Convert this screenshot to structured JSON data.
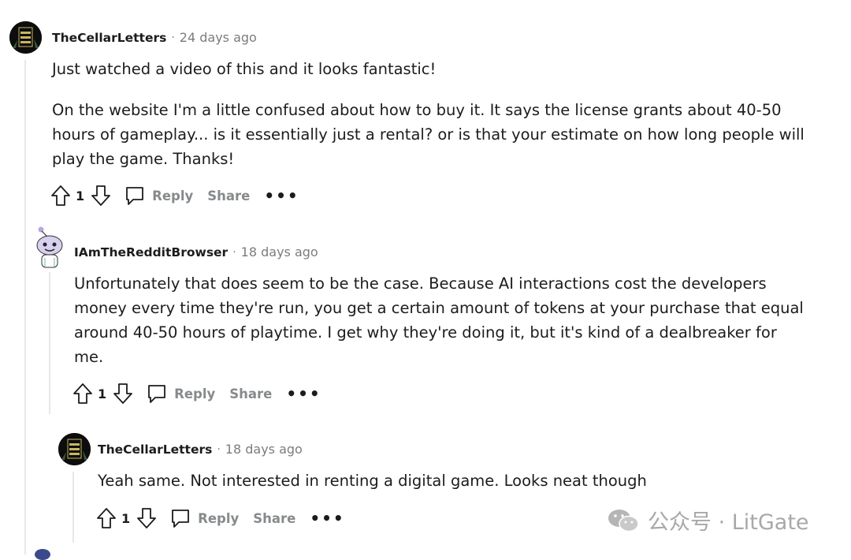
{
  "comments": [
    {
      "author": "TheCellarLetters",
      "time": "24 days ago",
      "paragraphs": [
        "Just watched a video of this and it looks fantastic!",
        "On the website I'm a little confused about how to buy it. It says the license grants about 40-50 hours of gameplay... is it essentially just a rental? or is that your estimate on how long people will play the game. Thanks!"
      ],
      "score": "1",
      "reply_label": "Reply",
      "share_label": "Share",
      "more_label": "•••",
      "avatar_text": "CELLAR LETTERS"
    },
    {
      "author": "IAmTheRedditBrowser",
      "time": "18 days ago",
      "paragraphs": [
        "Unfortunately that does seem to be the case. Because AI interactions cost the developers money every time they're run, you get a certain amount of tokens at your purchase that equal around 40-50 hours of playtime. I get why they're doing it, but it's kind of a dealbreaker for me."
      ],
      "score": "1",
      "reply_label": "Reply",
      "share_label": "Share",
      "more_label": "•••"
    },
    {
      "author": "TheCellarLetters",
      "time": "18 days ago",
      "paragraphs": [
        "Yeah same. Not interested in renting a digital game. Looks neat though"
      ],
      "score": "1",
      "reply_label": "Reply",
      "share_label": "Share",
      "more_label": "•••",
      "avatar_text": "CELLAR LETTERS"
    }
  ],
  "separator": "·",
  "watermark": {
    "text": "公众号 · LitGate"
  }
}
